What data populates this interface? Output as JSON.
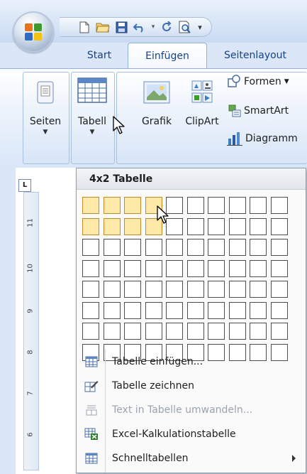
{
  "tabs": {
    "start": "Start",
    "insert": "Einfügen",
    "layout": "Seitenlayout"
  },
  "ribbon": {
    "pages_label": "Seiten",
    "table_label": "Tabell",
    "picture_label": "Grafik",
    "clipart_label": "ClipArt",
    "shapes_label": "Formen",
    "smartart_label": "SmartArt",
    "chart_label": "Diagramm"
  },
  "ruler": {
    "tab_marker": "L",
    "numbers": [
      "11",
      "10",
      "9",
      "8",
      "7",
      "6"
    ]
  },
  "table_dropdown": {
    "header": "4x2 Tabelle",
    "grid_columns": 10,
    "grid_rows": 8,
    "selected_columns": 4,
    "selected_rows": 2,
    "items": [
      {
        "label": "Tabelle einfügen...",
        "enabled": true,
        "icon": "insert-table-icon"
      },
      {
        "label": "Tabelle zeichnen",
        "enabled": true,
        "icon": "draw-table-icon"
      },
      {
        "label": "Text in Tabelle umwandeln...",
        "enabled": false,
        "icon": "convert-text-icon"
      },
      {
        "label": "Excel-Kalkulationstabelle",
        "enabled": true,
        "icon": "excel-sheet-icon"
      },
      {
        "label": "Schnelltabellen",
        "enabled": true,
        "icon": "quick-tables-icon",
        "submenu": true
      }
    ]
  },
  "colors": {
    "accent": "#15428b",
    "ribbon_border": "#8db2e3",
    "grid_highlight": "#ffe9a8"
  }
}
